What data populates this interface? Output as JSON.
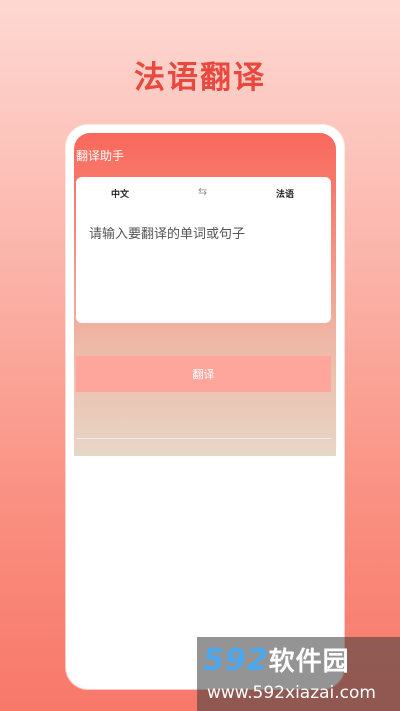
{
  "headline": "法语翻译",
  "app": {
    "title": "翻译助手",
    "source_lang": "中文",
    "swap_icon": "⇆",
    "target_lang": "法语",
    "input_placeholder": "请输入要翻译的单词或句子",
    "translate_label": "翻译"
  },
  "watermark": {
    "brand_num": "592",
    "brand_cn": "软件园",
    "url": "www.592xiazai.com"
  },
  "colors": {
    "accent": "#e8493f",
    "button": "#fea59c"
  }
}
